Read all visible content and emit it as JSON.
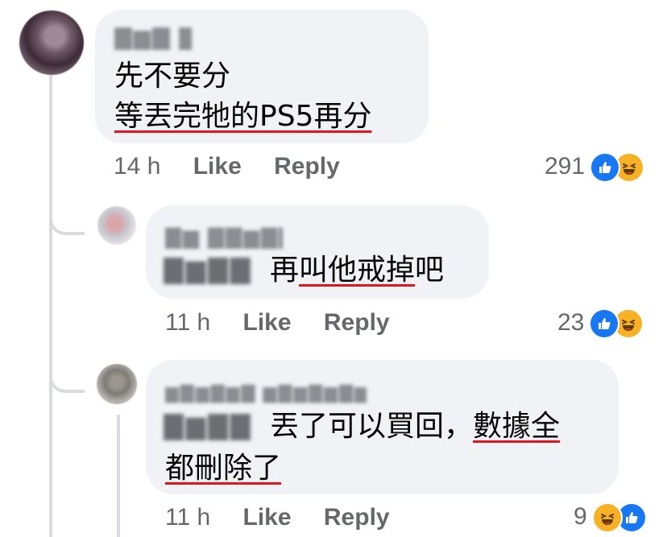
{
  "comments": [
    {
      "name_blurred": "▇▆▇ ▇",
      "text_line1": "先不要分",
      "text_line2_underlined": "等丟完牠的PS5再分",
      "time": "14 h",
      "like_label": "Like",
      "reply_label": "Reply",
      "reaction_count": "291"
    },
    {
      "name_blurred": "▇▆ ▇▇▆▇▇",
      "tag_blurred": "▇▆▇▇",
      "text_plain": "再",
      "text_underlined": "叫他戒掉",
      "text_after": "吧",
      "time": "11 h",
      "like_label": "Like",
      "reply_label": "Reply",
      "reaction_count": "23"
    },
    {
      "name_blurred": "▆▇▆▇▆▇ ▆▇▆▇▆▇▆",
      "tag_blurred": "▇▆▇▇",
      "text_plain": "丟了可以買回，",
      "text_underlined_a": "數據全",
      "text_underlined_b": "都刪除了",
      "time": "11 h",
      "like_label": "Like",
      "reply_label": "Reply",
      "reaction_count": "9"
    }
  ],
  "colors": {
    "bubble": "#f0f2f5",
    "meta_text": "#65676b",
    "underline": "#e4141c",
    "like_blue": "#1877f2",
    "haha_yellow": "#f7b125"
  },
  "icons": [
    "like-icon",
    "haha-icon"
  ]
}
